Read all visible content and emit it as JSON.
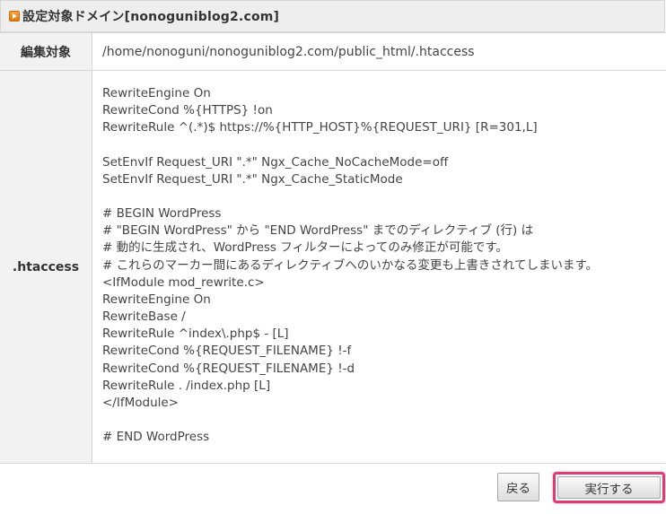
{
  "header": {
    "title": "設定対象ドメイン[nonoguniblog2.com]"
  },
  "form": {
    "target_label": "編集対象",
    "target_value": "/home/nonoguni/nonoguniblog2.com/public_html/.htaccess",
    "htaccess_label": ".htaccess",
    "htaccess_content": "RewriteEngine On\nRewriteCond %{HTTPS} !on\nRewriteRule ^(.*)$ https://%{HTTP_HOST}%{REQUEST_URI} [R=301,L]\n\nSetEnvIf Request_URI \".*\" Ngx_Cache_NoCacheMode=off\nSetEnvIf Request_URI \".*\" Ngx_Cache_StaticMode\n\n# BEGIN WordPress\n# \"BEGIN WordPress\" から \"END WordPress\" までのディレクティブ (行) は\n# 動的に生成され、WordPress フィルターによってのみ修正が可能です。\n# これらのマーカー間にあるディレクティブへのいかなる変更も上書きされてしまいます。\n<IfModule mod_rewrite.c>\nRewriteEngine On\nRewriteBase /\nRewriteRule ^index\\.php$ - [L]\nRewriteCond %{REQUEST_FILENAME} !-f\nRewriteCond %{REQUEST_FILENAME} !-d\nRewriteRule . /index.php [L]\n</IfModule>\n\n# END WordPress"
  },
  "actions": {
    "back_label": "戻る",
    "execute_label": "実行する",
    "highlight_color": "#e23b72"
  },
  "icons": {
    "header_icon": "orange-arrow-bullet-icon"
  }
}
